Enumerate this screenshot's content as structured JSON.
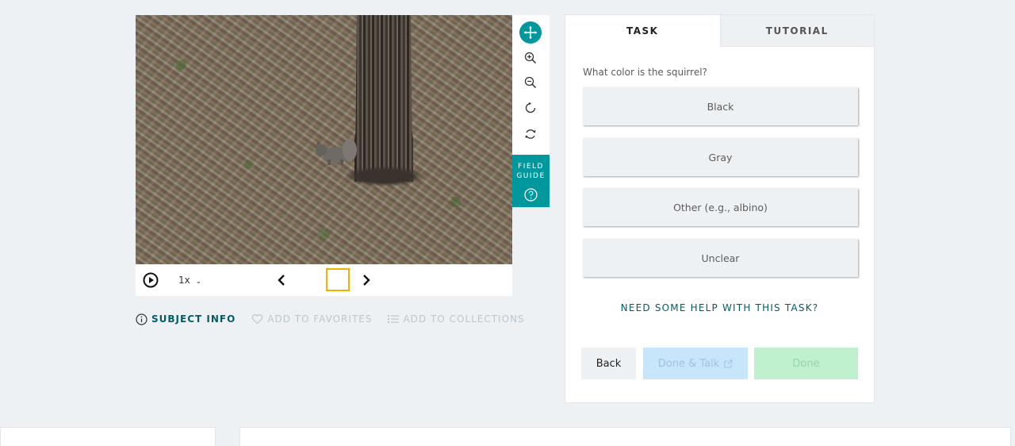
{
  "viewer": {
    "speed_label": "1x",
    "field_guide_label": "FIELD\nGUIDE"
  },
  "toolbar": {
    "icons": [
      "move-icon",
      "zoom-in-icon",
      "zoom-out-icon",
      "rotate-icon",
      "reset-icon"
    ]
  },
  "meta": {
    "subject_info": "SUBJECT INFO",
    "add_favorites": "ADD TO FAVORITES",
    "add_collections": "ADD TO COLLECTIONS"
  },
  "task": {
    "tabs": [
      {
        "label": "TASK",
        "active": true
      },
      {
        "label": "TUTORIAL",
        "active": false
      }
    ],
    "question": "What color is the squirrel?",
    "answers": [
      "Black",
      "Gray",
      "Other (e.g., albino)",
      "Unclear"
    ],
    "help_link": "NEED SOME HELP WITH THIS TASK?",
    "buttons": {
      "back": "Back",
      "done_talk": "Done & Talk",
      "done": "Done"
    }
  },
  "colors": {
    "accent": "#00979d",
    "link": "#005d69",
    "frame_highlight": "#f0b200",
    "background": "#eef1f4"
  }
}
